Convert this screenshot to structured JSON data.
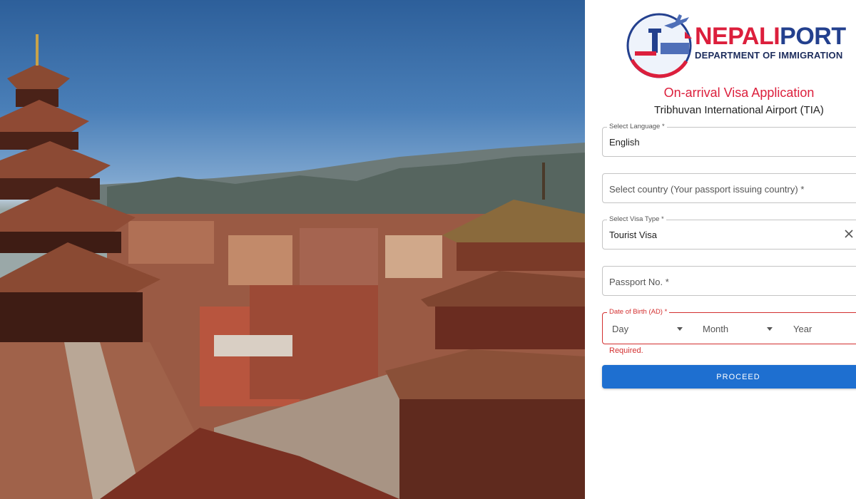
{
  "brand": {
    "name_part1": "NEPALI",
    "name_part2": "PORT",
    "subtitle": "DEPARTMENT OF IMMIGRATION"
  },
  "form": {
    "title": "On-arrival Visa Application",
    "subtitle": "Tribhuvan International Airport (TIA)",
    "language": {
      "label": "Select Language *",
      "value": "English"
    },
    "country": {
      "placeholder": "Select country (Your passport issuing country) *"
    },
    "visa_type": {
      "label": "Select Visa Type *",
      "value": "Tourist Visa"
    },
    "passport": {
      "placeholder": "Passport No. *"
    },
    "dob": {
      "label": "Date of Birth (AD) *",
      "day": "Day",
      "month": "Month",
      "year": "Year",
      "error": "Required."
    },
    "proceed_label": "PROCEED"
  },
  "icons": {
    "clear": "close-icon",
    "dropdown": "caret-down-icon",
    "logo": "airport-plane-logo-icon"
  },
  "colors": {
    "brand_red": "#dc1f3c",
    "brand_blue": "#23408e",
    "primary_button": "#1e6fd0",
    "error": "#d32f2f"
  }
}
